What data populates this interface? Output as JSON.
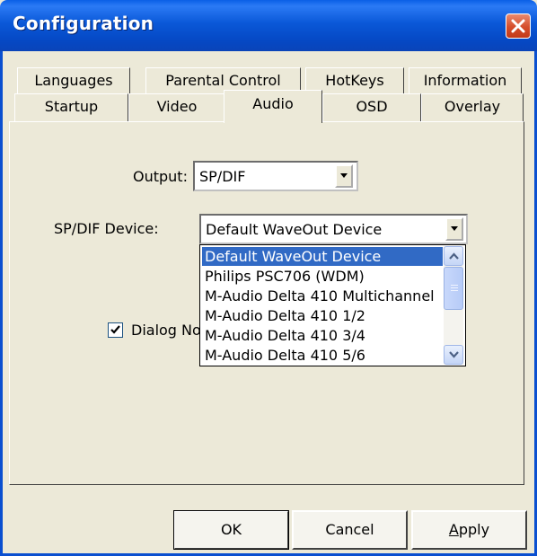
{
  "window": {
    "title": "Configuration"
  },
  "tabs_row1": [
    "Languages",
    "Parental Control",
    "HotKeys",
    "Information"
  ],
  "tabs_row2": [
    "Startup",
    "Video",
    "Audio",
    "OSD",
    "Overlay"
  ],
  "active_tab": "Audio",
  "audio": {
    "output_label": "Output:",
    "output_value": "SP/DIF",
    "spdif_label": "SP/DIF Device:",
    "spdif_value": "Default WaveOut Device",
    "dropdown_options": [
      "Default WaveOut Device",
      "Philips PSC706 (WDM)",
      "M-Audio Delta 410 Multichannel",
      "M-Audio Delta 410 1/2",
      "M-Audio Delta 410 3/4",
      "M-Audio Delta 410 5/6"
    ],
    "selected_option": "Default WaveOut Device",
    "checkbox_label": "Dialog No",
    "checkbox_checked": true
  },
  "buttons": {
    "ok": "OK",
    "cancel": "Cancel",
    "apply_underlined": "A",
    "apply_rest": "pply"
  },
  "icons": {
    "close": "close-icon",
    "dropdown": "chevron-down-icon",
    "check": "check-icon"
  },
  "colors": {
    "titlebar": "#0a58d8",
    "close": "#d54d2a",
    "selection": "#316ac5",
    "face": "#ece9d8"
  }
}
